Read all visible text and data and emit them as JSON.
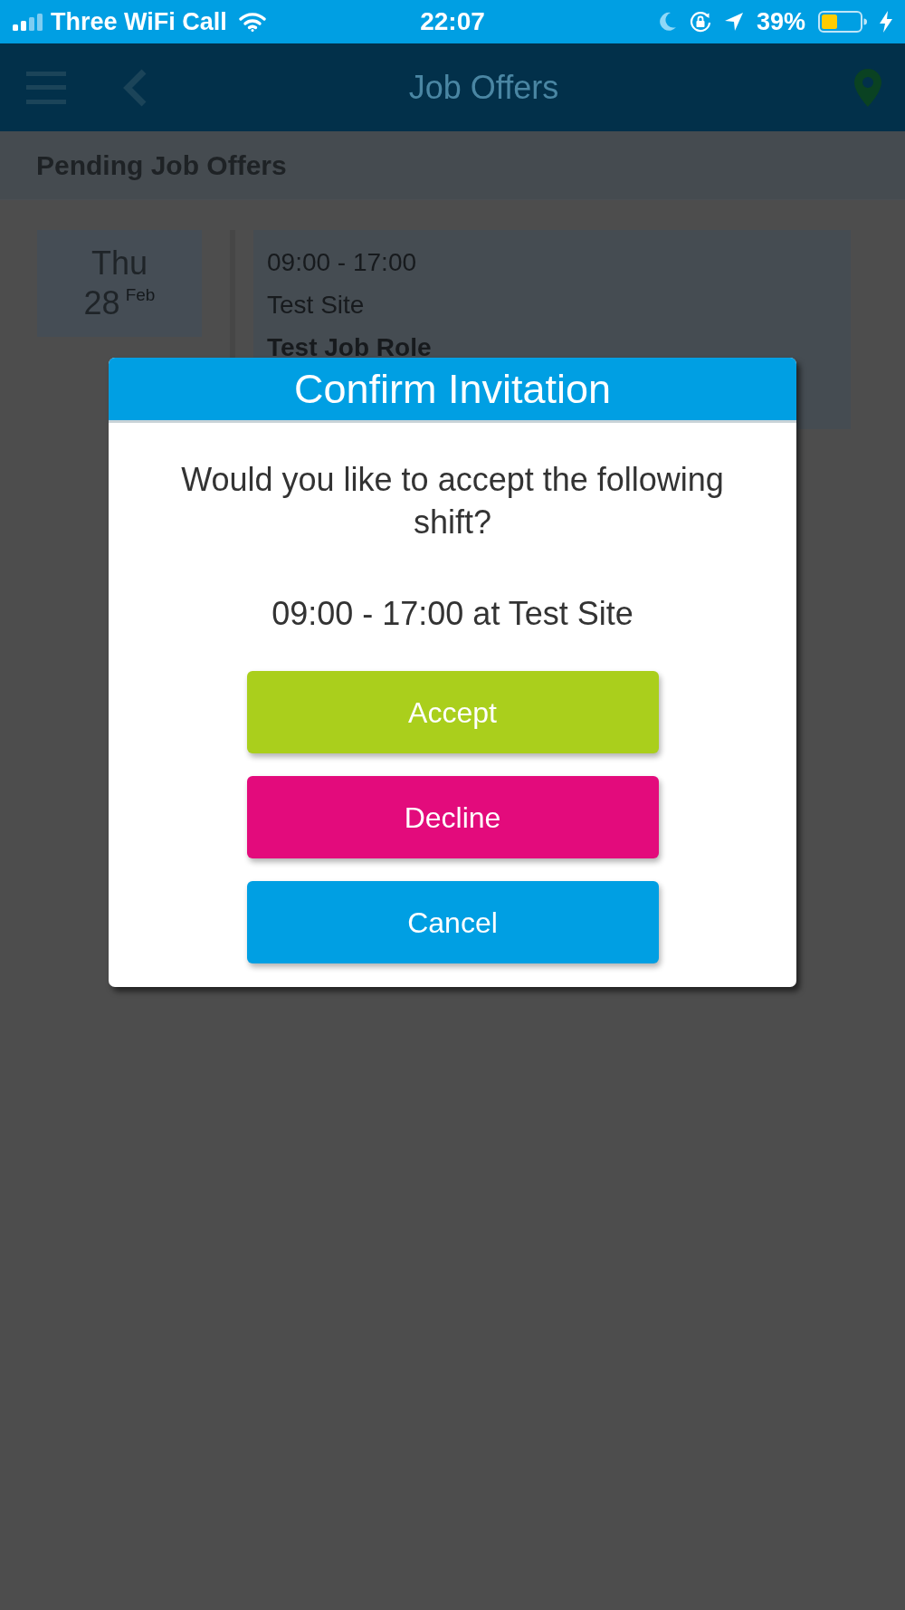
{
  "status_bar": {
    "carrier": "Three WiFi Call",
    "time": "22:07",
    "battery_percent": "39%"
  },
  "header": {
    "title": "Job Offers"
  },
  "section": {
    "title": "Pending Job Offers"
  },
  "offers": [
    {
      "weekday": "Thu",
      "day": "28",
      "month": "Feb",
      "time": "09:00 - 17:00",
      "site": "Test Site",
      "role": "Test Job Role"
    }
  ],
  "dialog": {
    "title": "Confirm Invitation",
    "message": "Would you like to accept the following shift?",
    "detail": "09:00 - 17:00 at Test Site",
    "buttons": [
      {
        "label": "Accept",
        "kind": "accept"
      },
      {
        "label": "Decline",
        "kind": "decline"
      },
      {
        "label": "Cancel",
        "kind": "cancel"
      }
    ]
  }
}
